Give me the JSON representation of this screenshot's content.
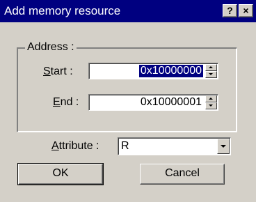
{
  "dialog": {
    "title": "Add memory resource",
    "help_button": "?",
    "close_button": "×"
  },
  "address": {
    "legend": "Address :",
    "start": {
      "label_accel": "S",
      "label_rest": "tart :",
      "value": "0x10000000"
    },
    "end": {
      "label_accel": "E",
      "label_rest": "nd :",
      "value": "0x10000001"
    }
  },
  "attribute": {
    "label_accel": "A",
    "label_rest": "ttribute :",
    "value": "R"
  },
  "buttons": {
    "ok": "OK",
    "cancel": "Cancel"
  },
  "colors": {
    "titlebar": "#000080",
    "face": "#d4d0c8",
    "selection": "#000080"
  }
}
